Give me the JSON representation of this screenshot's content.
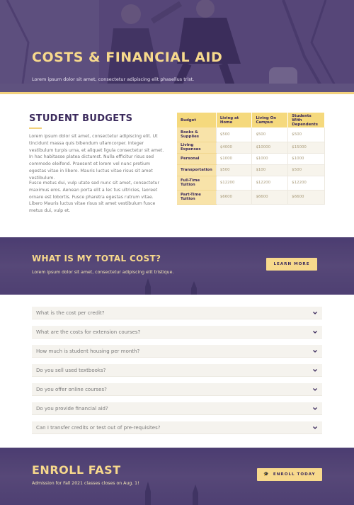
{
  "hero": {
    "title": "COSTS & FINANCIAL AID",
    "subtitle": "Lorem ipsum dolor sit amet, consectetur adipiscing elit phasellus trist."
  },
  "budgets": {
    "title": "STUDENT BUDGETS",
    "paragraph1": "Lorem ipsum dolor sit amet, consectetur adipiscing elit. Ut tincidunt massa quis bibendum ullamcorper. Integer vestibulum turpis urna, et aliquet ligula consectetur sit amet. In hac habitasse platea dictumst. Nulla efficitur risus sed commodo eleifend. Praesent et lorem vel nunc pretium egestas vitae in libero. Mauris luctus vitae risus sit amet vestibulum.",
    "paragraph2": "Fusce metus dui, vulp utate sed nunc sit amet, consectetur maximus eros. Aenean porta elit a lec tus ultricies, laoreet ornare est lobortis. Fusce pharetra egestas rutrum vitae. Libero Mauris luctus vitae risus sit amet vestibulum fusce metus dui, vulp et.",
    "table": {
      "headers": [
        "Budget",
        "Living at Home",
        "Living On Campus",
        "Students With Dependents"
      ],
      "rows": [
        [
          "Books & Supplies",
          "$500",
          "$500",
          "$500"
        ],
        [
          "Living Expenses",
          "$4000",
          "$10000",
          "$15000"
        ],
        [
          "Personal",
          "$1000",
          "$1000",
          "$1000"
        ],
        [
          "Transportation",
          "$500",
          "$100",
          "$500"
        ],
        [
          "Full-Time Tuition",
          "$12200",
          "$12200",
          "$12200"
        ],
        [
          "Part-Time Tuition",
          "$6600",
          "$6600",
          "$6600"
        ]
      ]
    }
  },
  "total_cost": {
    "title": "WHAT IS MY TOTAL COST?",
    "subtitle": "Lorem ipsum dolor sit amet, consectetur adipiscing elit tristique.",
    "button_label": "LEARN MORE"
  },
  "faq": [
    {
      "question": "What is the cost per credit?",
      "icon": "chevron-down-icon"
    },
    {
      "question": "What are the costs for extension courses?",
      "icon": "chevron-down-icon"
    },
    {
      "question": "How much is student housing per month?",
      "icon": "chevron-down-icon"
    },
    {
      "question": "Do you sell used textbooks?",
      "icon": "chevron-down-icon"
    },
    {
      "question": "Do you offer online courses?",
      "icon": "chevron-down-icon"
    },
    {
      "question": "Do you provide financial aid?",
      "icon": "chevron-down-icon"
    },
    {
      "question": "Can I transfer credits or test out of pre-requisites?",
      "icon": "chevron-down-icon"
    }
  ],
  "enroll": {
    "title": "ENROLL FAST",
    "subtitle": "Admission for Fall 2021 classes closes on Aug. 1!",
    "button_label": "ENROLL TODAY",
    "button_icon": "graduation-cap-icon"
  },
  "colors": {
    "purple": "#3b2a5c",
    "gold": "#f7d98c",
    "band": "#4a3b70"
  }
}
